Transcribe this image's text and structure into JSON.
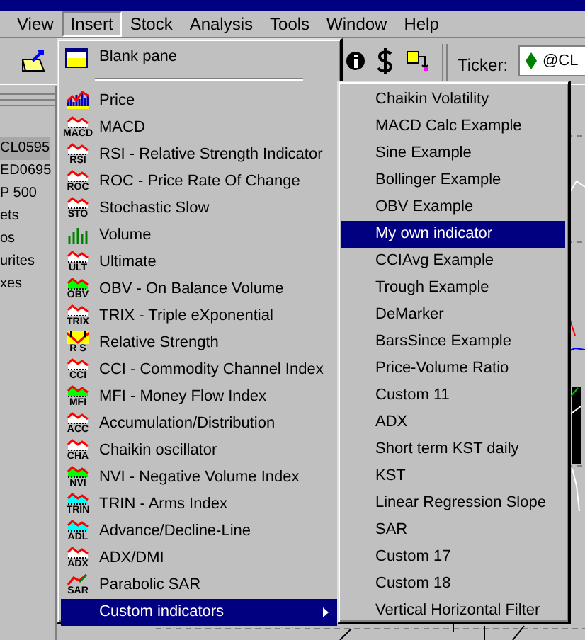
{
  "menu_bar": [
    {
      "label": "View",
      "selected": false
    },
    {
      "label": "Insert",
      "selected": true
    },
    {
      "label": "Stock",
      "selected": false
    },
    {
      "label": "Analysis",
      "selected": false
    },
    {
      "label": "Tools",
      "selected": false
    },
    {
      "label": "Window",
      "selected": false
    },
    {
      "label": "Help",
      "selected": false
    }
  ],
  "toolbar": {
    "ticker_label": "Ticker:",
    "ticker_value": "@CL"
  },
  "symbol_list": [
    {
      "label": "CL0595",
      "selected": true
    },
    {
      "label": "ED0695",
      "selected": false
    },
    {
      "label": "P 500",
      "selected": false
    },
    {
      "label": "ets",
      "selected": false
    },
    {
      "label": "os",
      "selected": false
    },
    {
      "label": "urites",
      "selected": false
    },
    {
      "label": "xes",
      "selected": false
    }
  ],
  "insert_menu": {
    "blank_pane": "Blank pane",
    "items": [
      {
        "label": "Price",
        "kind": "bars",
        "selected": false
      },
      {
        "label": "MACD",
        "kind": "wave",
        "tag": "MACD",
        "color": "#ffffff",
        "selected": false
      },
      {
        "label": "RSI - Relative Strength Indicator",
        "kind": "wave",
        "tag": "RSI",
        "color": "#ffffff",
        "selected": false
      },
      {
        "label": "ROC - Price Rate Of Change",
        "kind": "wave",
        "tag": "ROC",
        "color": "#ffffff",
        "selected": false
      },
      {
        "label": "Stochastic Slow",
        "kind": "wave",
        "tag": "STO",
        "color": "#ffffff",
        "selected": false
      },
      {
        "label": "Volume",
        "kind": "volume",
        "selected": false
      },
      {
        "label": "Ultimate",
        "kind": "wave",
        "tag": "ULT",
        "color": "#ffffff",
        "selected": false
      },
      {
        "label": "OBV - On Balance Volume",
        "kind": "wave",
        "tag": "OBV",
        "color": "#00ff00",
        "selected": false
      },
      {
        "label": "TRIX - Triple eXponential",
        "kind": "wave",
        "tag": "TRIX",
        "color": "#ffffff",
        "selected": false
      },
      {
        "label": "Relative Strength",
        "kind": "rs",
        "tag": "R S",
        "color": "#ffff00",
        "selected": false
      },
      {
        "label": "CCI -  Commodity Channel Index",
        "kind": "wave",
        "tag": "CCI",
        "color": "#ffffff",
        "selected": false
      },
      {
        "label": "MFI - Money Flow Index",
        "kind": "wave",
        "tag": "MFI",
        "color": "#00ff00",
        "selected": false
      },
      {
        "label": "Accumulation/Distribution",
        "kind": "wave",
        "tag": "ACC",
        "color": "#ffffff",
        "selected": false
      },
      {
        "label": "Chaikin oscillator",
        "kind": "wave",
        "tag": "CHA",
        "color": "#ffffff",
        "selected": false
      },
      {
        "label": "NVI - Negative Volume Index",
        "kind": "wave",
        "tag": "NVI",
        "color": "#00ff00",
        "selected": false
      },
      {
        "label": "TRIN - Arms Index",
        "kind": "wave",
        "tag": "TRIN",
        "color": "#00ffff",
        "selected": false
      },
      {
        "label": "Advance/Decline-Line",
        "kind": "wave",
        "tag": "ADL",
        "color": "#00ffff",
        "selected": false
      },
      {
        "label": "ADX/DMI",
        "kind": "wave",
        "tag": "ADX",
        "color": "#ffffff",
        "selected": false
      },
      {
        "label": "Parabolic SAR",
        "kind": "sar",
        "tag": "SAR",
        "selected": false
      },
      {
        "label": "Custom indicators",
        "kind": "submenu",
        "selected": true
      }
    ]
  },
  "custom_indicators": [
    {
      "label": "Chaikin Volatility",
      "selected": false
    },
    {
      "label": "MACD Calc Example",
      "selected": false
    },
    {
      "label": "Sine Example",
      "selected": false
    },
    {
      "label": "Bollinger Example",
      "selected": false
    },
    {
      "label": "OBV Example",
      "selected": false
    },
    {
      "label": "My own indicator",
      "selected": true
    },
    {
      "label": "CCIAvg Example",
      "selected": false
    },
    {
      "label": "Trough Example",
      "selected": false
    },
    {
      "label": "DeMarker",
      "selected": false
    },
    {
      "label": "BarsSince Example",
      "selected": false
    },
    {
      "label": "Price-Volume Ratio",
      "selected": false
    },
    {
      "label": "Custom 11",
      "selected": false
    },
    {
      "label": "ADX",
      "selected": false
    },
    {
      "label": "Short term KST daily",
      "selected": false
    },
    {
      "label": "KST",
      "selected": false
    },
    {
      "label": "Linear Regression Slope",
      "selected": false
    },
    {
      "label": "SAR",
      "selected": false
    },
    {
      "label": "Custom 17",
      "selected": false
    },
    {
      "label": "Custom 18",
      "selected": false
    },
    {
      "label": "Vertical Horizontal Filter",
      "selected": false
    }
  ]
}
